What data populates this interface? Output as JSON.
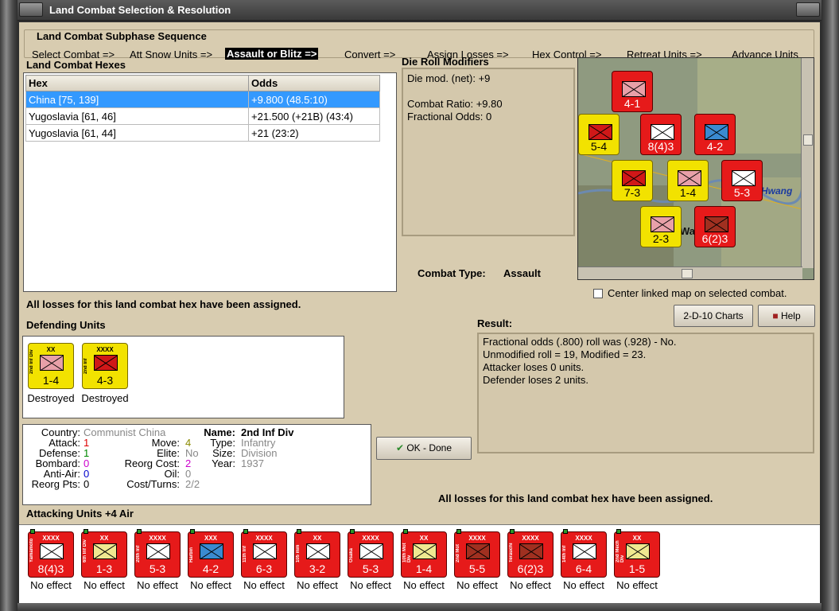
{
  "window": {
    "title": "Land Combat Selection & Resolution"
  },
  "subphase": {
    "label": "Land Combat Subphase Sequence",
    "items": [
      "Select Combat =>",
      "Att Snow Units =>",
      "Assault or Blitz =>",
      "Convert =>",
      "Assign Losses =>",
      "Hex Control =>",
      "Retreat Units =>",
      "Advance Units"
    ],
    "active_index": 2
  },
  "hexes": {
    "label": "Land Combat Hexes",
    "columns": [
      "Hex",
      "Odds"
    ],
    "rows": [
      {
        "hex": "China [75, 139]",
        "odds": "+9.800 (48.5:10)"
      },
      {
        "hex": "Yugoslavia [61, 46]",
        "odds": "+21.500 (+21B) (43:4)"
      },
      {
        "hex": "Yugoslavia [61, 44]",
        "odds": "+21 (23:2)"
      }
    ]
  },
  "dieroll": {
    "label": "Die Roll Modifiers",
    "net": "Die mod. (net): +9",
    "ratio": "Combat Ratio: +9.80",
    "fractional": "Fractional Odds: 0"
  },
  "combat_type": {
    "label": "Combat Type:",
    "value": "Assault"
  },
  "center_map": {
    "label": "Center linked map on selected combat."
  },
  "losses_msg": "All losses for this land combat hex have been assigned.",
  "losses_msg_2": "All losses for this land combat hex have been assigned.",
  "buttons": {
    "charts": "2-D-10 Charts",
    "help": "Help",
    "ok": "OK - Done"
  },
  "defending": {
    "label": "Defending Units",
    "units": [
      {
        "size": "XX",
        "name": "2nd Inf Div",
        "strength": "1-4",
        "status": "Destroyed"
      },
      {
        "size": "XXXX",
        "name": "2nd Inf",
        "strength": "4-3",
        "status": "Destroyed"
      }
    ]
  },
  "result": {
    "label": "Result:",
    "lines": [
      "Fractional odds (.800) roll was (.928)  - No.",
      "Unmodified roll = 19, Modified = 23.",
      "Attacker loses 0 units.",
      "Defender loses 2 units."
    ]
  },
  "unit_info": {
    "country_label": "Country:",
    "country": "Communist China",
    "attack_label": "Attack:",
    "attack": "1",
    "defense_label": "Defense:",
    "defense": "1",
    "bombard_label": "Bombard:",
    "bombard": "0",
    "antiair_label": "Anti-Air:",
    "antiair": "0",
    "reorgpts_label": "Reorg Pts:",
    "reorgpts": "0",
    "move_label": "Move:",
    "move": "4",
    "elite_label": "Elite:",
    "elite": "No",
    "reorgcost_label": "Reorg Cost:",
    "reorgcost": "2",
    "oil_label": "Oil:",
    "oil": "0",
    "costturns_label": "Cost/Turns:",
    "costturns": "2/2",
    "name_label": "Name:",
    "name": "2nd Inf Div",
    "type_label": "Type:",
    "type": "Infantry",
    "size_label": "Size:",
    "size": "Division",
    "year_label": "Year:",
    "year": "1937"
  },
  "attacking": {
    "label": "Attacking Units +4 Air",
    "units": [
      {
        "size": "XXXX",
        "name": "Yamamoto",
        "strength": "8(4)3",
        "status": "No effect",
        "box": "white"
      },
      {
        "size": "XX",
        "name": "6th Inf Div",
        "strength": "1-3",
        "status": "No effect",
        "box": "lyellow"
      },
      {
        "size": "XXXX",
        "name": "20th Inf",
        "strength": "5-3",
        "status": "No effect",
        "box": "white"
      },
      {
        "size": "XXX",
        "name": "Harbin",
        "strength": "4-2",
        "status": "No effect",
        "box": "blue"
      },
      {
        "size": "XXXX",
        "name": "11th Inf",
        "strength": "6-3",
        "status": "No effect",
        "box": "white"
      },
      {
        "size": "XX",
        "name": "105 mm",
        "strength": "3-2",
        "status": "No effect",
        "box": "white"
      },
      {
        "size": "XXXX",
        "name": "Osaka",
        "strength": "5-3",
        "status": "No effect",
        "box": "white"
      },
      {
        "size": "XX",
        "name": "10th Mot Div",
        "strength": "1-4",
        "status": "No effect",
        "box": "lyellow"
      },
      {
        "size": "XXXX",
        "name": "2nd Mot",
        "strength": "5-5",
        "status": "No effect",
        "box": "brown"
      },
      {
        "size": "XXXX",
        "name": "Terauchi",
        "strength": "6(2)3",
        "status": "No effect",
        "box": "brown"
      },
      {
        "size": "XXXX",
        "name": "14th Inf",
        "strength": "6-4",
        "status": "No effect",
        "box": "white"
      },
      {
        "size": "XX",
        "name": "2nd Mech Div",
        "strength": "1-5",
        "status": "No effect",
        "box": "lyellow"
      }
    ]
  },
  "map": {
    "labels": [
      "Hwang",
      "Wa"
    ],
    "counters": [
      {
        "strength": "4-1",
        "color": "red"
      },
      {
        "strength": "5-4",
        "color": "yellow"
      },
      {
        "strength": "8(4)3",
        "color": "red"
      },
      {
        "strength": "4-2",
        "color": "red"
      },
      {
        "strength": "7-3",
        "color": "yellow"
      },
      {
        "strength": "1-4",
        "color": "yellow"
      },
      {
        "strength": "5-3",
        "color": "red"
      },
      {
        "strength": "2-3",
        "color": "yellow"
      },
      {
        "strength": "6(2)3",
        "color": "red"
      }
    ]
  }
}
